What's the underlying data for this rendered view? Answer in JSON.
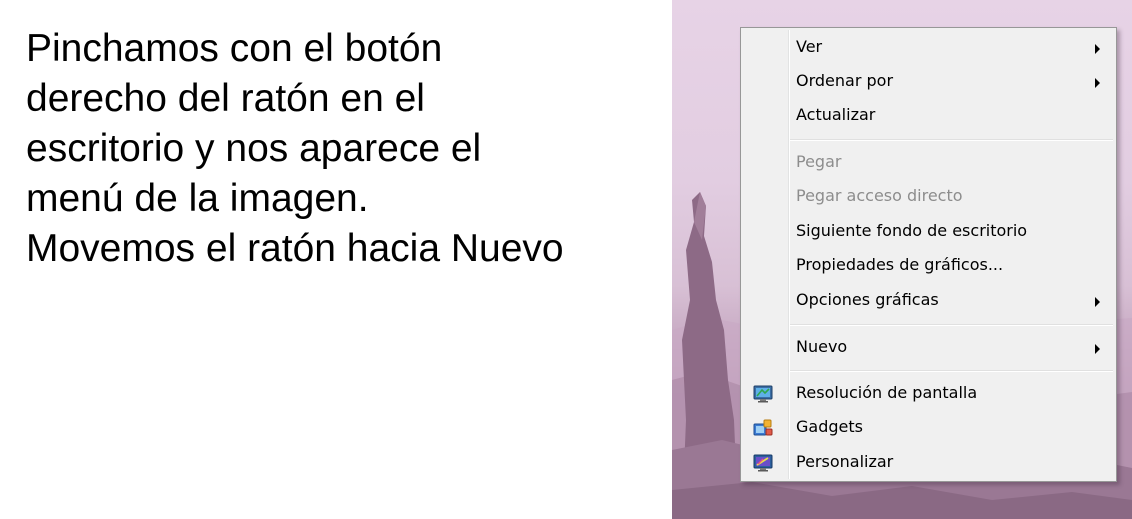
{
  "instruction": {
    "lines": [
      "Pinchamos con el botón",
      "derecho del ratón en el",
      "escritorio y nos aparece el",
      "menú de la imagen.",
      "Movemos el ratón hacia Nuevo"
    ]
  },
  "context_menu": {
    "items": [
      {
        "label": "Ver",
        "submenu": true,
        "enabled": true
      },
      {
        "label": "Ordenar por",
        "submenu": true,
        "enabled": true
      },
      {
        "label": "Actualizar",
        "submenu": false,
        "enabled": true
      },
      {
        "label": "Pegar",
        "submenu": false,
        "enabled": false
      },
      {
        "label": "Pegar acceso directo",
        "submenu": false,
        "enabled": false
      },
      {
        "label": "Siguiente fondo de escritorio",
        "submenu": false,
        "enabled": true
      },
      {
        "label": "Propiedades de gráficos...",
        "submenu": false,
        "enabled": true
      },
      {
        "label": "Opciones gráficas",
        "submenu": true,
        "enabled": true
      },
      {
        "label": "Nuevo",
        "submenu": true,
        "enabled": true
      },
      {
        "label": "Resolución de pantalla",
        "submenu": false,
        "enabled": true,
        "icon": "screen-resolution-icon"
      },
      {
        "label": "Gadgets",
        "submenu": false,
        "enabled": true,
        "icon": "gadgets-icon"
      },
      {
        "label": "Personalizar",
        "submenu": false,
        "enabled": true,
        "icon": "personalize-icon"
      }
    ]
  }
}
